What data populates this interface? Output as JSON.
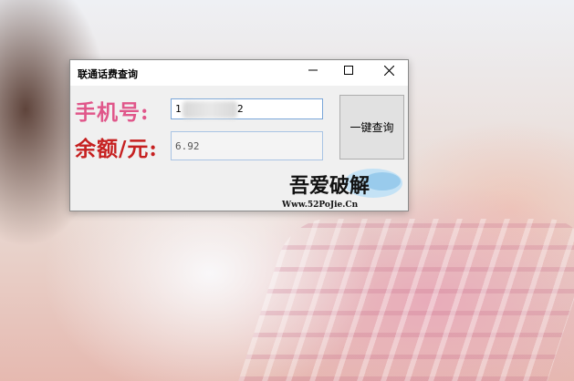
{
  "window": {
    "title": "联通话费查询",
    "controls": {
      "minimize": "minimize-icon",
      "maximize": "maximize-icon",
      "close": "close-icon"
    }
  },
  "form": {
    "phone_label": "手机号:",
    "phone_value_visible": "1",
    "phone_value_tail": "2",
    "balance_label": "余额/元:",
    "balance_value": "6.92"
  },
  "actions": {
    "query_label": "一键查询"
  },
  "watermark": {
    "top": "吾爱破解",
    "url": "Www.52PoJie.Cn"
  },
  "colors": {
    "phone_label": "#e0568a",
    "balance_label": "#c62020",
    "field_border": "#7aa7d9"
  }
}
